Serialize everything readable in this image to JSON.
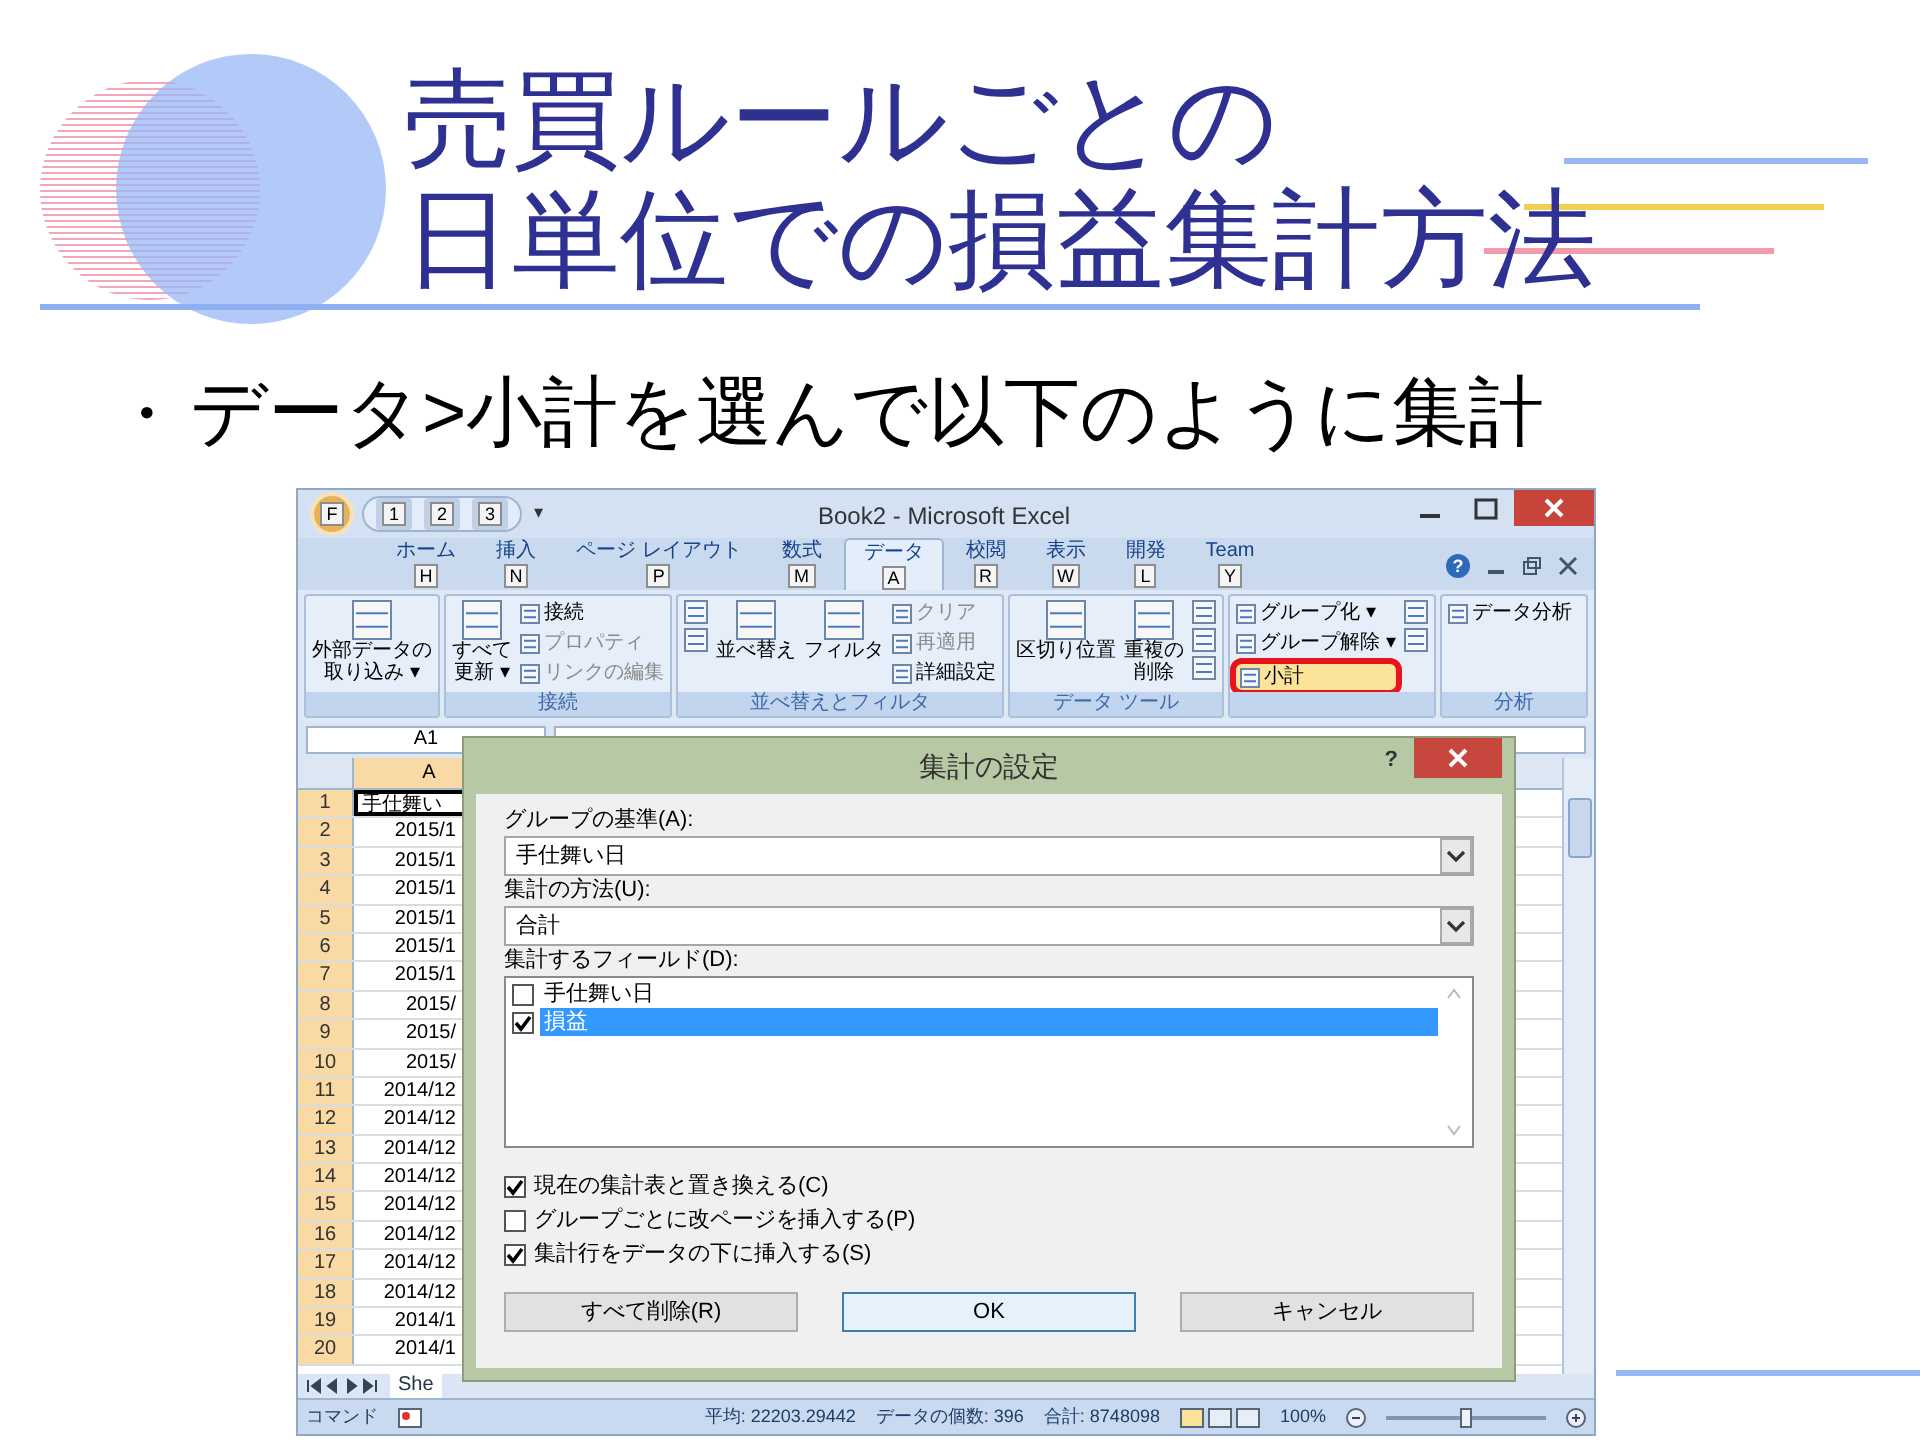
{
  "slide": {
    "title_lines": [
      "売買ルールごとの",
      "日単位での損益集計方法"
    ],
    "bullet_mark": "・",
    "bullet_text": "データ>小計を選んで以下のように集計"
  },
  "excel": {
    "window_title": "Book2 - Microsoft Excel",
    "office_keytip": "F",
    "quick_access_keytips": [
      "1",
      "2",
      "3"
    ],
    "customize_glyph": "▾",
    "ribbon_help": "?",
    "tabs": [
      {
        "label": "ホーム",
        "keytip": "H",
        "selected": false
      },
      {
        "label": "挿入",
        "keytip": "N",
        "selected": false
      },
      {
        "label": "ページ レイアウト",
        "keytip": "P",
        "selected": false
      },
      {
        "label": "数式",
        "keytip": "M",
        "selected": false
      },
      {
        "label": "データ",
        "keytip": "A",
        "selected": true
      },
      {
        "label": "校閲",
        "keytip": "R",
        "selected": false
      },
      {
        "label": "表示",
        "keytip": "W",
        "selected": false
      },
      {
        "label": "開発",
        "keytip": "L",
        "selected": false
      },
      {
        "label": "Team",
        "keytip": "Y",
        "selected": false
      }
    ],
    "ribbon_groups": [
      {
        "columns": [
          [
            {
              "kind": "large",
              "lines": [
                "外部データの",
                "取り込み ▾"
              ],
              "disabled": false
            }
          ]
        ]
      },
      {
        "label": "接続",
        "columns": [
          [
            {
              "kind": "large",
              "lines": [
                "すべて",
                "更新 ▾"
              ],
              "disabled": false
            }
          ],
          [
            {
              "kind": "small",
              "lines": [
                "接続"
              ],
              "disabled": false
            },
            {
              "kind": "small",
              "lines": [
                "プロパティ"
              ],
              "disabled": true
            },
            {
              "kind": "small",
              "lines": [
                "リンクの編集"
              ],
              "disabled": true
            }
          ]
        ]
      },
      {
        "label": "並べ替えとフィルタ",
        "columns": [
          [
            {
              "kind": "icon",
              "disabled": false
            },
            {
              "kind": "icon",
              "disabled": false
            }
          ],
          [
            {
              "kind": "large",
              "lines": [
                "並べ替え"
              ],
              "disabled": false
            }
          ],
          [
            {
              "kind": "large",
              "lines": [
                "フィルタ"
              ],
              "disabled": false
            }
          ],
          [
            {
              "kind": "small",
              "lines": [
                "クリア"
              ],
              "disabled": true
            },
            {
              "kind": "small",
              "lines": [
                "再適用"
              ],
              "disabled": true
            },
            {
              "kind": "small",
              "lines": [
                "詳細設定"
              ],
              "disabled": false
            }
          ]
        ]
      },
      {
        "label": "データ ツール",
        "columns": [
          [
            {
              "kind": "large",
              "lines": [
                "区切り位置"
              ],
              "disabled": false
            }
          ],
          [
            {
              "kind": "large",
              "lines": [
                "重複の",
                "削除"
              ],
              "disabled": false
            }
          ],
          [
            {
              "kind": "icon",
              "disabled": false
            },
            {
              "kind": "icon",
              "disabled": false
            },
            {
              "kind": "icon",
              "disabled": false
            }
          ]
        ]
      },
      {
        "columns": [
          [
            {
              "kind": "small",
              "lines": [
                "グループ化 ▾"
              ],
              "disabled": false
            },
            {
              "kind": "small",
              "lines": [
                "グループ解除 ▾"
              ],
              "disabled": false
            },
            {
              "kind": "callout",
              "lines": [
                "小計"
              ],
              "disabled": false
            }
          ],
          [
            {
              "kind": "icon",
              "disabled": false
            },
            {
              "kind": "icon",
              "disabled": false
            }
          ]
        ]
      },
      {
        "label": "分析",
        "columns": [
          [
            {
              "kind": "small",
              "lines": [
                "データ分析"
              ],
              "disabled": false
            }
          ]
        ]
      }
    ],
    "name_box": "A1",
    "column_header": "A",
    "rows": [
      {
        "header": "1",
        "cell": "手仕舞い",
        "kind": "text"
      },
      {
        "header": "2",
        "cell": "2015/1",
        "kind": "date"
      },
      {
        "header": "3",
        "cell": "2015/1",
        "kind": "date"
      },
      {
        "header": "4",
        "cell": "2015/1",
        "kind": "date"
      },
      {
        "header": "5",
        "cell": "2015/1",
        "kind": "date"
      },
      {
        "header": "6",
        "cell": "2015/1",
        "kind": "date"
      },
      {
        "header": "7",
        "cell": "2015/1",
        "kind": "date"
      },
      {
        "header": "8",
        "cell": "2015/",
        "kind": "date"
      },
      {
        "header": "9",
        "cell": "2015/",
        "kind": "date"
      },
      {
        "header": "10",
        "cell": "2015/",
        "kind": "date"
      },
      {
        "header": "11",
        "cell": "2014/12",
        "kind": "date"
      },
      {
        "header": "12",
        "cell": "2014/12",
        "kind": "date"
      },
      {
        "header": "13",
        "cell": "2014/12",
        "kind": "date"
      },
      {
        "header": "14",
        "cell": "2014/12",
        "kind": "date"
      },
      {
        "header": "15",
        "cell": "2014/12",
        "kind": "date"
      },
      {
        "header": "16",
        "cell": "2014/12",
        "kind": "date"
      },
      {
        "header": "17",
        "cell": "2014/12",
        "kind": "date"
      },
      {
        "header": "18",
        "cell": "2014/12",
        "kind": "date"
      },
      {
        "header": "19",
        "cell": "2014/1",
        "kind": "date"
      },
      {
        "header": "20",
        "cell": "2014/1",
        "kind": "date"
      }
    ],
    "sheet_tab": "She",
    "status_bar": {
      "mode": "コマンド",
      "average": "平均: 22203.29442",
      "count": "データの個数: 396",
      "sum": "合計: 8748098",
      "zoom": "100%",
      "zoom_slider": {
        "level": 0.5
      }
    },
    "dialog": {
      "title": "集計の設定",
      "help": "?",
      "group_by": {
        "label": "グループの基準(A):",
        "value": "手仕舞い日"
      },
      "method": {
        "label": "集計の方法(U):",
        "value": "合計"
      },
      "fields": {
        "label": "集計するフィールド(D):",
        "items": [
          {
            "label": "手仕舞い日",
            "checked": false,
            "selected": false
          },
          {
            "label": "損益",
            "checked": true,
            "selected": true
          }
        ]
      },
      "options": [
        {
          "label": "現在の集計表と置き換える(C)",
          "checked": true
        },
        {
          "label": "グループごとに改ページを挿入する(P)",
          "checked": false
        },
        {
          "label": "集計行をデータの下に挿入する(S)",
          "checked": true
        }
      ],
      "buttons": [
        {
          "label": "すべて削除(R)",
          "default": false
        },
        {
          "label": "OK",
          "default": true
        },
        {
          "label": "キャンセル",
          "default": false
        }
      ]
    }
  }
}
